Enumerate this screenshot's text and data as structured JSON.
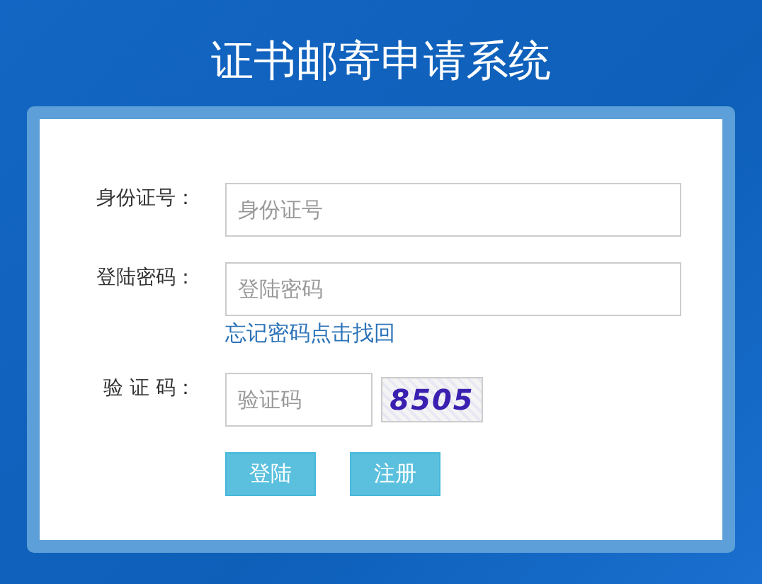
{
  "title": "证书邮寄申请系统",
  "fields": [
    {
      "kind": "text",
      "label": "身份证号：",
      "placeholder": "身份证号"
    },
    {
      "kind": "password",
      "label": "登陆密码：",
      "placeholder": "登陆密码",
      "link": "忘记密码点击找回"
    },
    {
      "kind": "captcha",
      "label": "验 证 码：",
      "placeholder": "验证码",
      "captcha": "8505"
    }
  ],
  "buttons": [
    "登陆",
    "注册"
  ]
}
